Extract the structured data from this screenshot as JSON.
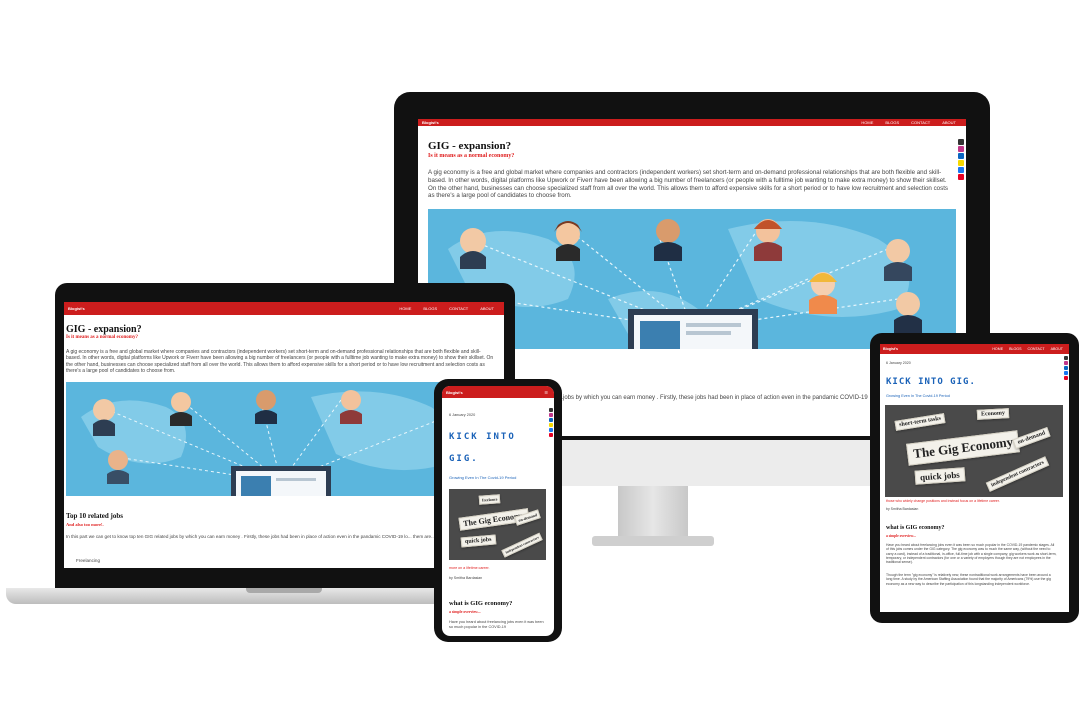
{
  "site": {
    "brand": "Blogist's",
    "nav": [
      "HOME",
      "BLOGS",
      "CONTACT",
      "ABOUT"
    ]
  },
  "desktop": {
    "title": "GIG - expansion?",
    "subtitle": "Is it means as a normal economy?",
    "paragraph": "A gig economy is a free and global market where companies and contractors (independent workers) set short-term and on-demand professional relationships that are both flexible and skill-based. In other words, digital platforms like Upwork or Fiverr have been allowing a big number of freelancers (or people with a fulltime job wanting to make extra money) to show their skillset. On the other hand, businesses can choose specialized staff from all over the world. This allows them to afford expensive skills for a short period or to have low recruitment and selection costs as there's a large pool of candidates to choose from.",
    "lower_text": "...jobs by which you can earn money . Firstly, these jobs had been in place of action even in the pandamic COVID-19"
  },
  "laptop": {
    "title": "GIG - expansion?",
    "subtitle": "Is it means as a normal economy?",
    "paragraph": "A gig economy is a free and global market where companies and contractors (independent workers) set short-term and on-demand professional relationships that are both flexible and skill-based. In other words, digital platforms like Upwork or Fiverr have been allowing a big number of freelancers (or people with a fulltime job wanting to make extra money) to show their skillset. On the other hand, businesses can choose specialized staff from all over the world. This allows them to afford expensive skills for a short period or to have low recruitment and selection costs as there's a large pool of candidates to choose from.",
    "section_title": "Top 10 related jobs",
    "section_sub": "And also too more!.",
    "section_text": "In this part we can get to know top ten GIG related jobs by which you can earn money . Firstly, these jobs had been in place of action even in the pandamic COVID-19 lo... them are..",
    "list_item": "Freelancing"
  },
  "phone": {
    "date": "6 January 2020",
    "headline_1": "KICK INTO",
    "headline_2": "GIG.",
    "tagline": "Growing Even In The Covid-19 Period",
    "caption": "more on a lifetime career.",
    "author": "by Smitha Bardasian",
    "section_title": "what is GIG economy?",
    "section_sub": "a simple overview...",
    "section_text": "Have you heard about freelancing jobs even it was been so much popular in the COVID-19"
  },
  "tablet": {
    "date": "6 January 2020",
    "headline": "KICK INTO GIG.",
    "tagline": "Growing Even In The Covid-19 Period",
    "caption": "those who widely change positions and instead focus on a lifetime career.",
    "author": "by Smitha Bardasian",
    "section_title": "what is GIG economy?",
    "section_sub": "a simple overview...",
    "para1": "Have you heard about freelancing jobs even it was been so much popular in the COVID-19 pandemic stages. All of this jobs comes under the GIG category. The gig economy was to much the same way, (without the need to carry a card), instead of a traditional, in-office, full-time job with a single company; gig workers work as short-term, temporary, or independent contractors (for one or a variety of employers though they are not employees in the traditional sense).",
    "para2": "Though the term \"gig economy\" is relatively new, these nontraditional work arrangements have been around a long time. A study by the American Staffing Association found that the majority of Americans (79%) use the gig economy as a new way to describe the participation of this longstanding independent workforce."
  },
  "newspaper_words": {
    "big": "The Gig Economy",
    "w1": "quick jobs",
    "w2": "on-demand",
    "w3": "short-term tasks",
    "w4": "independent contractors",
    "w5": "freelance",
    "w6": "Economy"
  },
  "colors": {
    "brand_red": "#cc1d1d",
    "link_blue": "#1a62b8",
    "map_blue": "#5bb6dd",
    "device_black": "#111111",
    "stand_gray": "#d9d9d9"
  }
}
